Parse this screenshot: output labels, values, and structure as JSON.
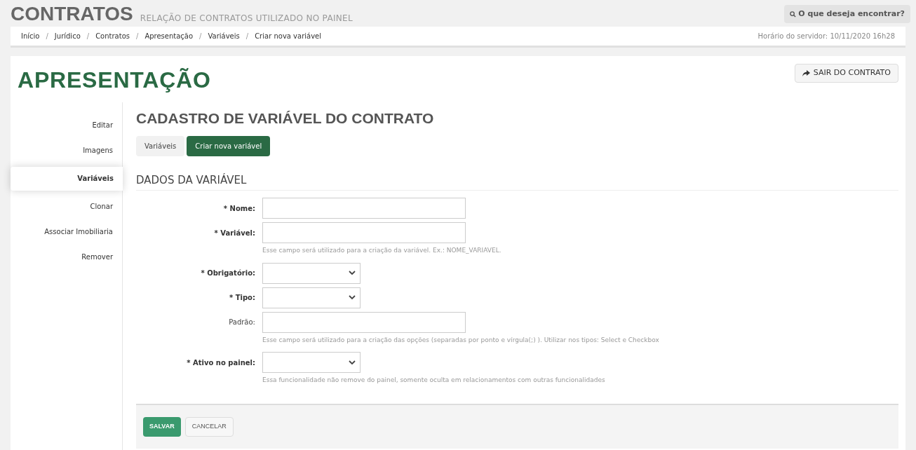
{
  "header": {
    "title": "CONTRATOS",
    "subtitle": "RELAÇÃO DE CONTRATOS UTILIZADO NO PAINEL",
    "search": "O que deseja encontrar?"
  },
  "breadcrumb": [
    "Início",
    "/",
    "Jurídico",
    "/",
    "Contratos",
    "/",
    "Apresentação",
    "/",
    "Variáveis",
    "/",
    "Criar nova variável"
  ],
  "server_time": "Horário do servidor: 10/11/2020 16h28",
  "page_title": "APRESENTAÇÃO",
  "exit_button": "SAIR DO CONTRATO",
  "sidebar": {
    "items": [
      {
        "label": "Editar",
        "selected": false
      },
      {
        "label": "Imagens",
        "selected": false
      },
      {
        "label": "Variáveis",
        "selected": true
      },
      {
        "label": "Clonar",
        "selected": false
      },
      {
        "label": "Associar Imobiliaria",
        "selected": false
      },
      {
        "label": "Remover",
        "selected": false
      }
    ]
  },
  "section_title": "CADASTRO DE VARIÁVEL DO CONTRATO",
  "tabs": [
    {
      "label": "Variáveis",
      "selected": false
    },
    {
      "label": "Criar nova variável",
      "selected": true
    }
  ],
  "form": {
    "title": "DADOS DA VARIÁVEL",
    "fields": [
      {
        "kind": "text",
        "label": "* Nome:",
        "required": true
      },
      {
        "kind": "text",
        "label": "* Variável:",
        "required": true,
        "help": "Esse campo será utilizado para a criação da variável. Ex.: NOME_VARIAVEL."
      },
      {
        "kind": "select",
        "label": "* Obrigatório:",
        "required": true
      },
      {
        "kind": "select",
        "label": "* Tipo:",
        "required": true
      },
      {
        "kind": "text",
        "label": "Padrão:",
        "required": false,
        "help": "Esse campo será utilizado para a criação das opções (separadas por ponto e vírgula(;) ). Utilizar nos tipos: Select e Checkbox"
      },
      {
        "kind": "select",
        "label": "* Ativo no painel:",
        "required": true,
        "help": "Essa funcionalidade não remove do painel, somente oculta em relacionamentos com outras funcionalidades"
      }
    ]
  },
  "buttons": [
    {
      "kind": "primary",
      "label": "SALVAR"
    },
    {
      "kind": "default",
      "label": "CANCELAR"
    }
  ]
}
